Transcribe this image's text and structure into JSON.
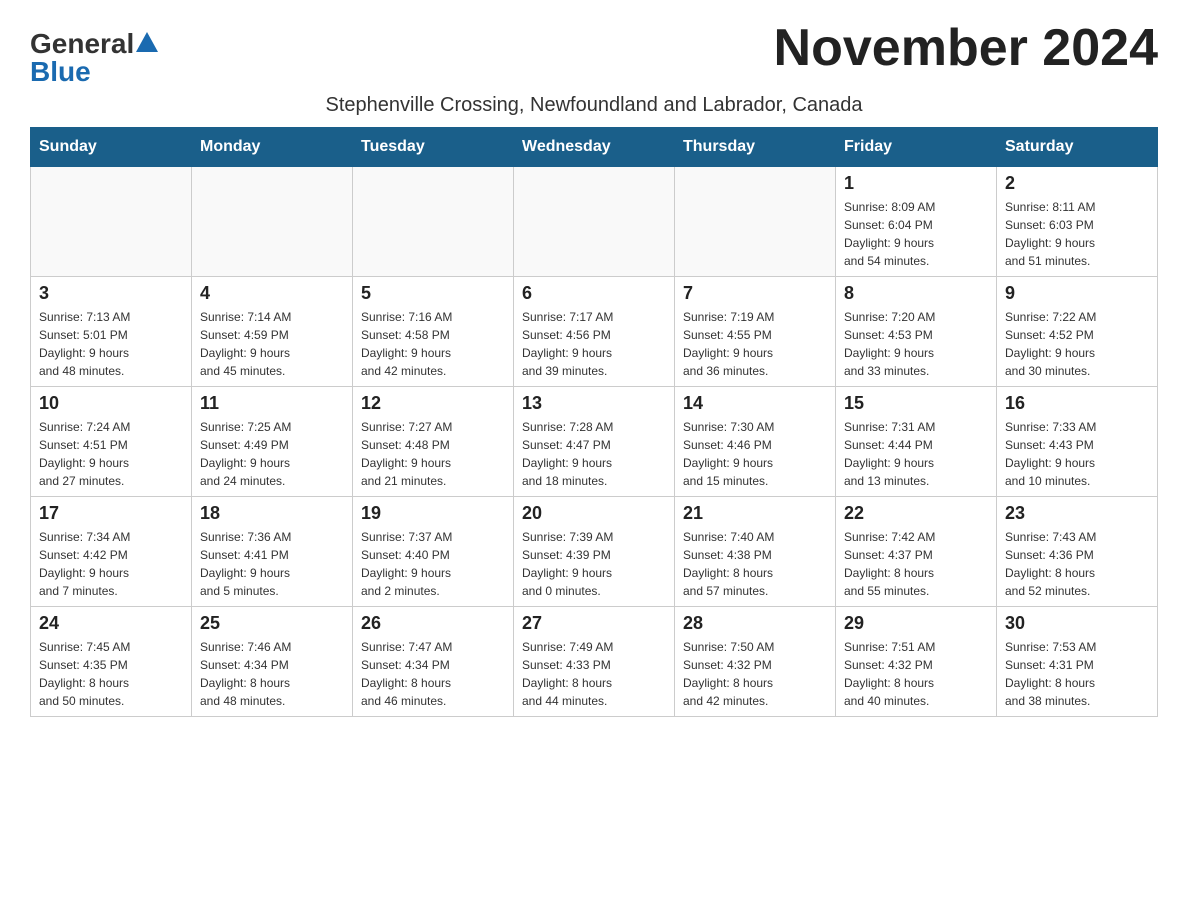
{
  "header": {
    "logo_general": "General",
    "logo_blue": "Blue",
    "month_title": "November 2024",
    "subtitle": "Stephenville Crossing, Newfoundland and Labrador, Canada"
  },
  "days_of_week": [
    "Sunday",
    "Monday",
    "Tuesday",
    "Wednesday",
    "Thursday",
    "Friday",
    "Saturday"
  ],
  "weeks": [
    [
      {
        "day": "",
        "info": ""
      },
      {
        "day": "",
        "info": ""
      },
      {
        "day": "",
        "info": ""
      },
      {
        "day": "",
        "info": ""
      },
      {
        "day": "",
        "info": ""
      },
      {
        "day": "1",
        "info": "Sunrise: 8:09 AM\nSunset: 6:04 PM\nDaylight: 9 hours\nand 54 minutes."
      },
      {
        "day": "2",
        "info": "Sunrise: 8:11 AM\nSunset: 6:03 PM\nDaylight: 9 hours\nand 51 minutes."
      }
    ],
    [
      {
        "day": "3",
        "info": "Sunrise: 7:13 AM\nSunset: 5:01 PM\nDaylight: 9 hours\nand 48 minutes."
      },
      {
        "day": "4",
        "info": "Sunrise: 7:14 AM\nSunset: 4:59 PM\nDaylight: 9 hours\nand 45 minutes."
      },
      {
        "day": "5",
        "info": "Sunrise: 7:16 AM\nSunset: 4:58 PM\nDaylight: 9 hours\nand 42 minutes."
      },
      {
        "day": "6",
        "info": "Sunrise: 7:17 AM\nSunset: 4:56 PM\nDaylight: 9 hours\nand 39 minutes."
      },
      {
        "day": "7",
        "info": "Sunrise: 7:19 AM\nSunset: 4:55 PM\nDaylight: 9 hours\nand 36 minutes."
      },
      {
        "day": "8",
        "info": "Sunrise: 7:20 AM\nSunset: 4:53 PM\nDaylight: 9 hours\nand 33 minutes."
      },
      {
        "day": "9",
        "info": "Sunrise: 7:22 AM\nSunset: 4:52 PM\nDaylight: 9 hours\nand 30 minutes."
      }
    ],
    [
      {
        "day": "10",
        "info": "Sunrise: 7:24 AM\nSunset: 4:51 PM\nDaylight: 9 hours\nand 27 minutes."
      },
      {
        "day": "11",
        "info": "Sunrise: 7:25 AM\nSunset: 4:49 PM\nDaylight: 9 hours\nand 24 minutes."
      },
      {
        "day": "12",
        "info": "Sunrise: 7:27 AM\nSunset: 4:48 PM\nDaylight: 9 hours\nand 21 minutes."
      },
      {
        "day": "13",
        "info": "Sunrise: 7:28 AM\nSunset: 4:47 PM\nDaylight: 9 hours\nand 18 minutes."
      },
      {
        "day": "14",
        "info": "Sunrise: 7:30 AM\nSunset: 4:46 PM\nDaylight: 9 hours\nand 15 minutes."
      },
      {
        "day": "15",
        "info": "Sunrise: 7:31 AM\nSunset: 4:44 PM\nDaylight: 9 hours\nand 13 minutes."
      },
      {
        "day": "16",
        "info": "Sunrise: 7:33 AM\nSunset: 4:43 PM\nDaylight: 9 hours\nand 10 minutes."
      }
    ],
    [
      {
        "day": "17",
        "info": "Sunrise: 7:34 AM\nSunset: 4:42 PM\nDaylight: 9 hours\nand 7 minutes."
      },
      {
        "day": "18",
        "info": "Sunrise: 7:36 AM\nSunset: 4:41 PM\nDaylight: 9 hours\nand 5 minutes."
      },
      {
        "day": "19",
        "info": "Sunrise: 7:37 AM\nSunset: 4:40 PM\nDaylight: 9 hours\nand 2 minutes."
      },
      {
        "day": "20",
        "info": "Sunrise: 7:39 AM\nSunset: 4:39 PM\nDaylight: 9 hours\nand 0 minutes."
      },
      {
        "day": "21",
        "info": "Sunrise: 7:40 AM\nSunset: 4:38 PM\nDaylight: 8 hours\nand 57 minutes."
      },
      {
        "day": "22",
        "info": "Sunrise: 7:42 AM\nSunset: 4:37 PM\nDaylight: 8 hours\nand 55 minutes."
      },
      {
        "day": "23",
        "info": "Sunrise: 7:43 AM\nSunset: 4:36 PM\nDaylight: 8 hours\nand 52 minutes."
      }
    ],
    [
      {
        "day": "24",
        "info": "Sunrise: 7:45 AM\nSunset: 4:35 PM\nDaylight: 8 hours\nand 50 minutes."
      },
      {
        "day": "25",
        "info": "Sunrise: 7:46 AM\nSunset: 4:34 PM\nDaylight: 8 hours\nand 48 minutes."
      },
      {
        "day": "26",
        "info": "Sunrise: 7:47 AM\nSunset: 4:34 PM\nDaylight: 8 hours\nand 46 minutes."
      },
      {
        "day": "27",
        "info": "Sunrise: 7:49 AM\nSunset: 4:33 PM\nDaylight: 8 hours\nand 44 minutes."
      },
      {
        "day": "28",
        "info": "Sunrise: 7:50 AM\nSunset: 4:32 PM\nDaylight: 8 hours\nand 42 minutes."
      },
      {
        "day": "29",
        "info": "Sunrise: 7:51 AM\nSunset: 4:32 PM\nDaylight: 8 hours\nand 40 minutes."
      },
      {
        "day": "30",
        "info": "Sunrise: 7:53 AM\nSunset: 4:31 PM\nDaylight: 8 hours\nand 38 minutes."
      }
    ]
  ]
}
